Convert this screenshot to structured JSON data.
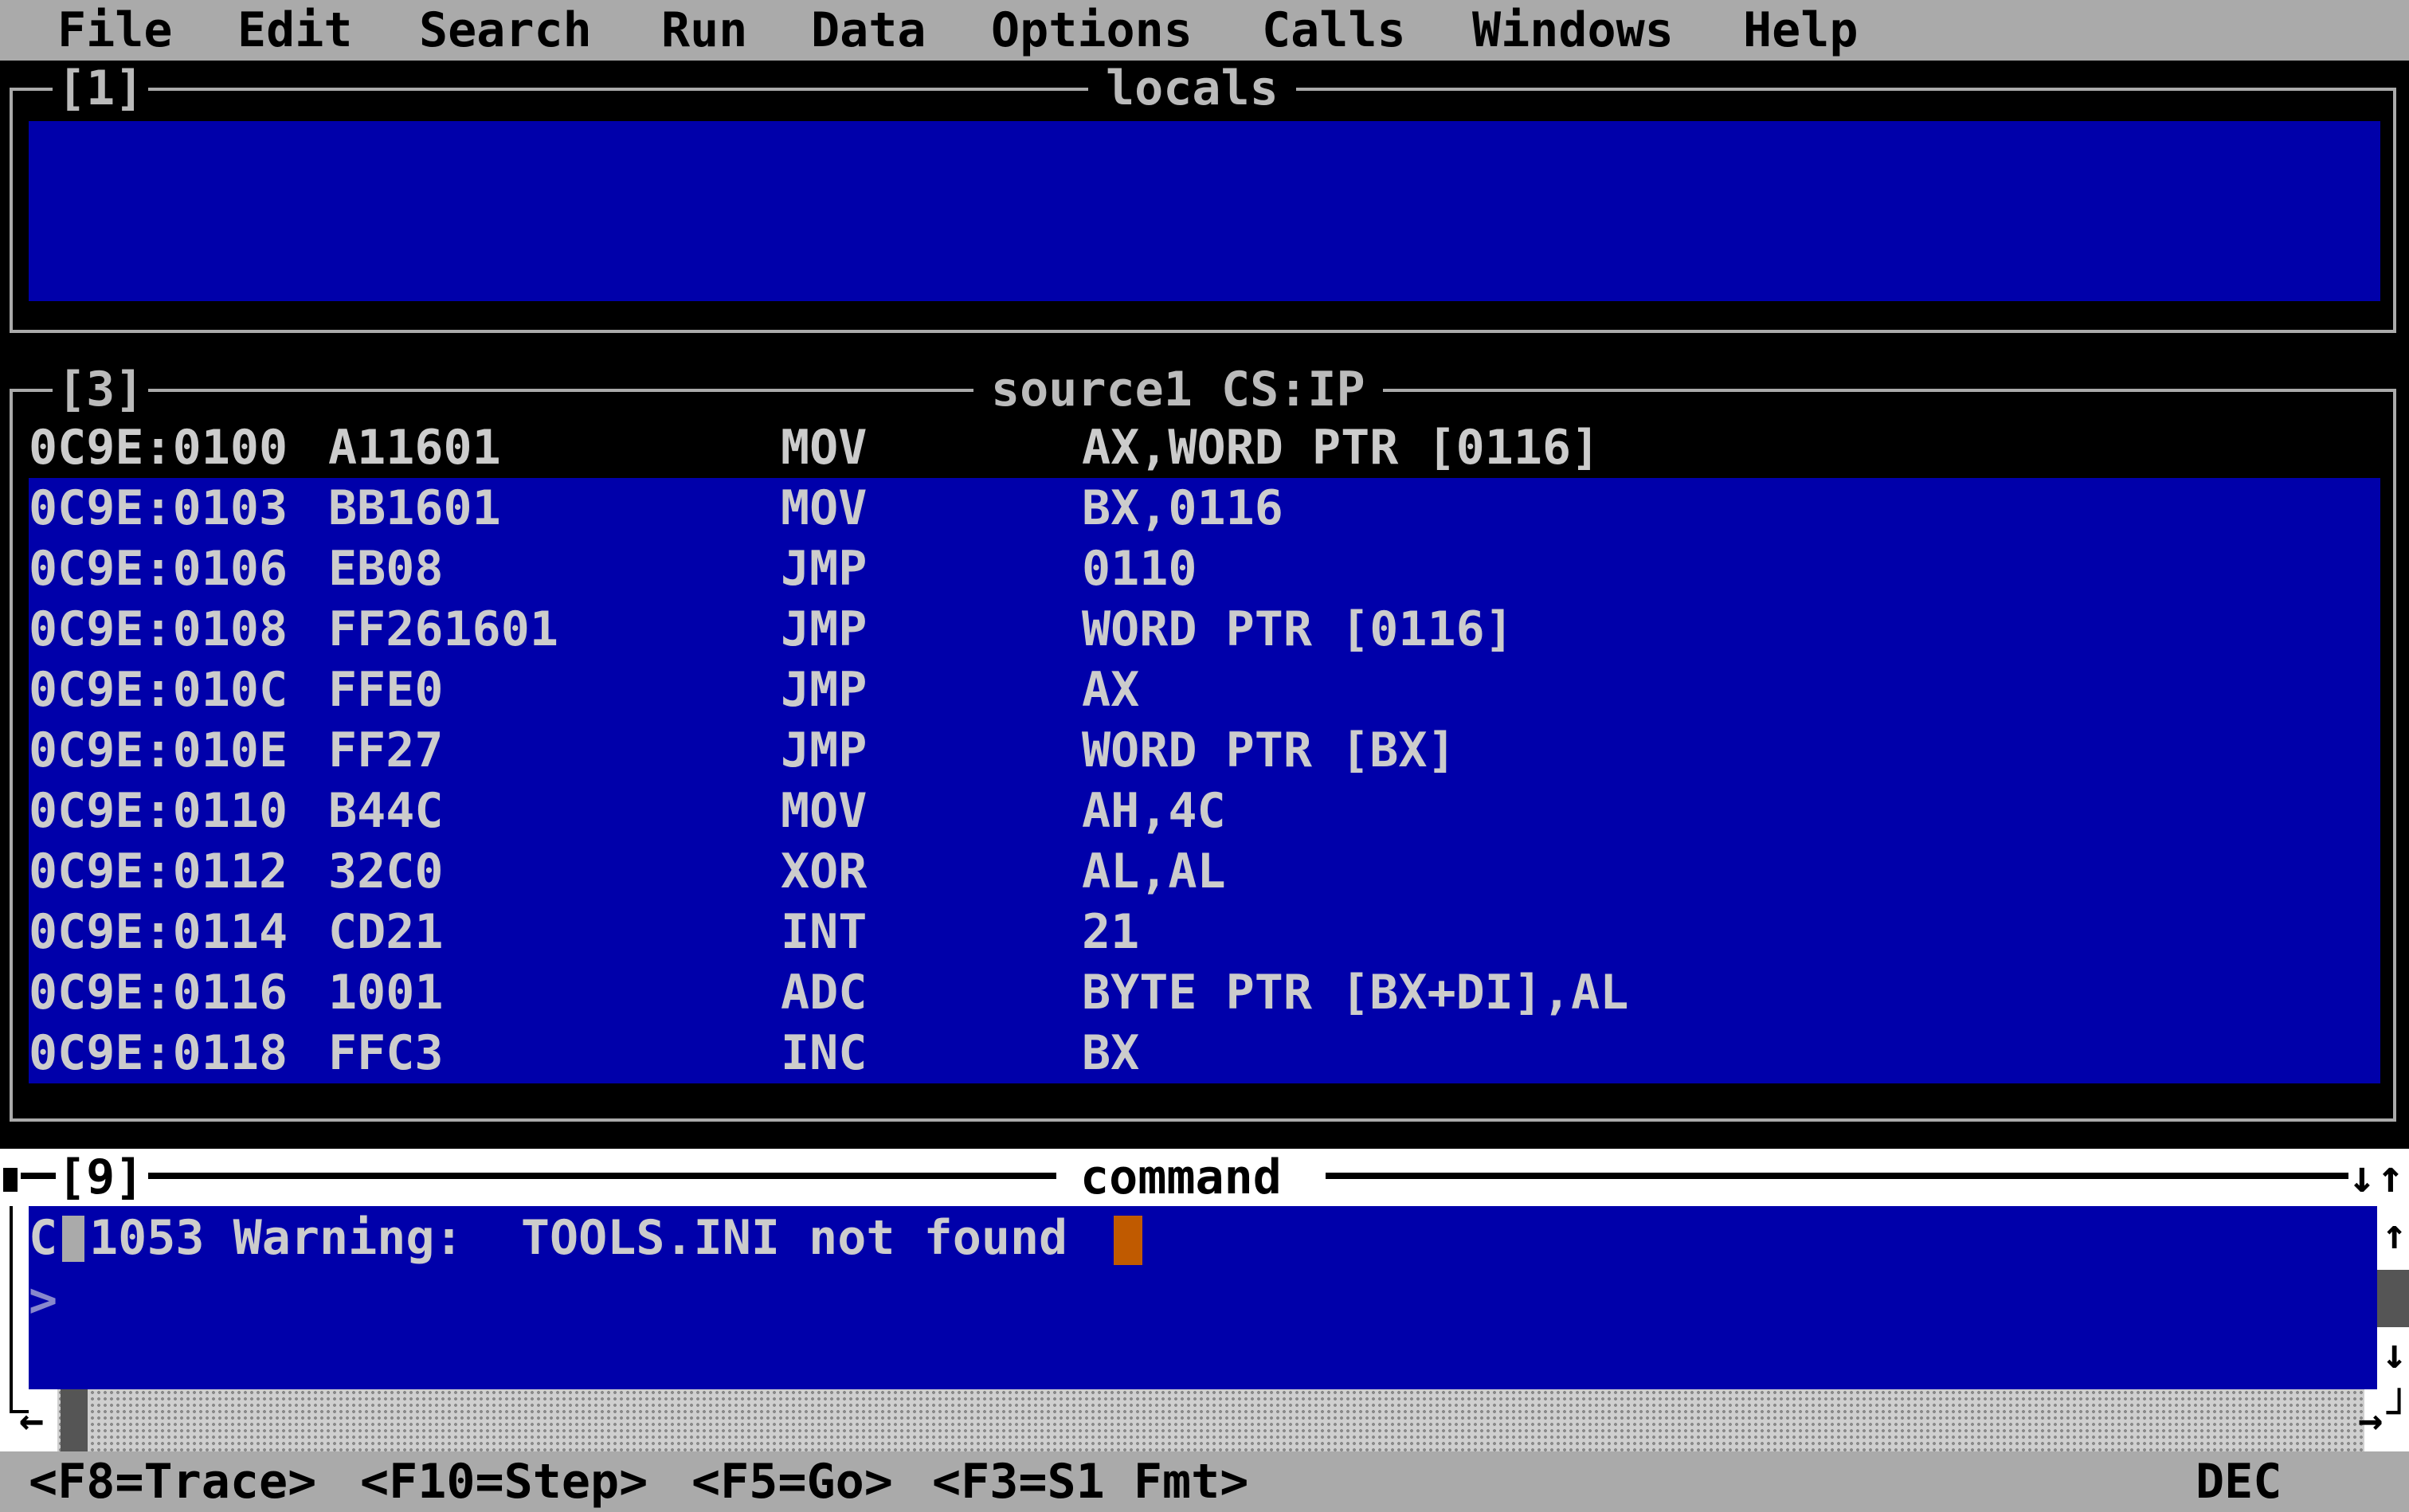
{
  "menu": [
    "File",
    "Edit",
    "Search",
    "Run",
    "Data",
    "Options",
    "Calls",
    "Windows",
    "Help"
  ],
  "locals_window": {
    "number": "[1]",
    "title": "locals"
  },
  "source_window": {
    "number": "[3]",
    "title": "source1 CS:IP",
    "rows": [
      {
        "addr": "0C9E:0100",
        "bytes": "A11601",
        "mnem": "MOV",
        "op": "AX,WORD PTR [0116]"
      },
      {
        "addr": "0C9E:0103",
        "bytes": "BB1601",
        "mnem": "MOV",
        "op": "BX,0116"
      },
      {
        "addr": "0C9E:0106",
        "bytes": "EB08",
        "mnem": "JMP",
        "op": "0110"
      },
      {
        "addr": "0C9E:0108",
        "bytes": "FF261601",
        "mnem": "JMP",
        "op": "WORD PTR [0116]"
      },
      {
        "addr": "0C9E:010C",
        "bytes": "FFE0",
        "mnem": "JMP",
        "op": "AX"
      },
      {
        "addr": "0C9E:010E",
        "bytes": "FF27",
        "mnem": "JMP",
        "op": "WORD PTR [BX]"
      },
      {
        "addr": "0C9E:0110",
        "bytes": "B44C",
        "mnem": "MOV",
        "op": "AH,4C"
      },
      {
        "addr": "0C9E:0112",
        "bytes": "32C0",
        "mnem": "XOR",
        "op": "AL,AL"
      },
      {
        "addr": "0C9E:0114",
        "bytes": "CD21",
        "mnem": "INT",
        "op": "21"
      },
      {
        "addr": "0C9E:0116",
        "bytes": "1001",
        "mnem": "ADC",
        "op": "BYTE PTR [BX+DI],AL"
      },
      {
        "addr": "0C9E:0118",
        "bytes": "FFC3",
        "mnem": "INC",
        "op": "BX"
      }
    ]
  },
  "command_window": {
    "number": "[9]",
    "title": "command",
    "warning_prefix": "C",
    "warning_text": "1053 Warning:  TOOLS.INI not found",
    "prompt": ">"
  },
  "status_bar": {
    "items": [
      "<F8=Trace>",
      "<F10=Step>",
      "<F5=Go>",
      "<F3=S1 Fmt>"
    ],
    "radix": "DEC"
  },
  "colors": {
    "window_bg": "#0000aa",
    "frame": "#aaaaaa",
    "text": "#cccccc",
    "highlight_row": "#000000",
    "cursor": "#c05a00"
  }
}
